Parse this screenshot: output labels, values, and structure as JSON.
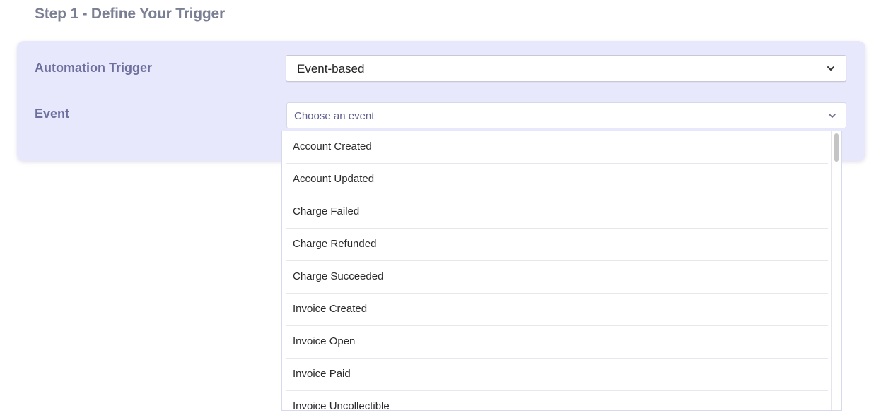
{
  "step_title": "Step 1 - Define Your Trigger",
  "trigger_card": {
    "automation_trigger_label": "Automation Trigger",
    "automation_trigger_value": "Event-based",
    "event_label": "Event",
    "event_placeholder": "Choose an event"
  },
  "event_options": [
    "Account Created",
    "Account Updated",
    "Charge Failed",
    "Charge Refunded",
    "Charge Succeeded",
    "Invoice Created",
    "Invoice Open",
    "Invoice Paid",
    "Invoice Uncollectible"
  ],
  "icons": {
    "select_chevron": "chevron-down-icon"
  },
  "colors": {
    "card_background": "#e8e8fc",
    "label_color": "#6d6f9e",
    "title_color": "#7a7f93",
    "placeholder_color": "#5f6190"
  }
}
